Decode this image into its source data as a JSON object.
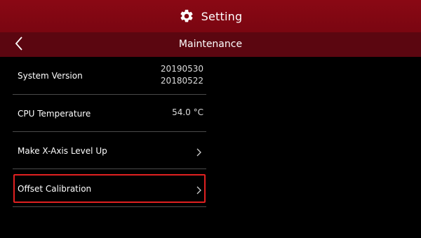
{
  "header": {
    "title": "Setting",
    "icon": "gear-icon",
    "background": "#8a0814"
  },
  "subheader": {
    "title": "Maintenance",
    "back_icon": "chevron-left-icon",
    "background": "#5b0610"
  },
  "items": [
    {
      "label": "System Version",
      "value_line1": "20190530",
      "value_line2": "20180522"
    },
    {
      "label": "CPU Temperature",
      "value": "54.0 °C"
    },
    {
      "label": "Make X-Axis Level Up",
      "icon": "chevron-right-icon"
    },
    {
      "label": "Offset Calibration",
      "icon": "chevron-right-icon",
      "highlighted": true
    }
  ],
  "colors": {
    "highlight_border": "#e02020",
    "divider": "#4a4a4a"
  }
}
